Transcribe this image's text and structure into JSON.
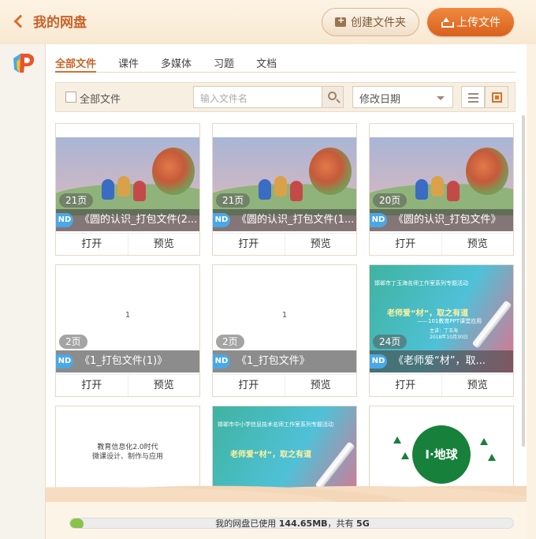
{
  "header": {
    "title": "我的网盘",
    "create_folder": "创建文件夹",
    "upload": "上传文件"
  },
  "tabs": [
    "全部文件",
    "课件",
    "多媒体",
    "习题",
    "文档"
  ],
  "active_tab": 0,
  "filter": {
    "select_all": "全部文件",
    "search_placeholder": "输入文件名",
    "sort": "修改日期"
  },
  "files": [
    {
      "badge": "ND",
      "pages": "21页",
      "name": "《圆的认识_打包文件(2...",
      "thumb": "cartoon"
    },
    {
      "badge": "ND",
      "pages": "21页",
      "name": "《圆的认识_打包文件(1...",
      "thumb": "cartoon"
    },
    {
      "badge": "ND",
      "pages": "20页",
      "name": "《圆的认识_打包文件》",
      "thumb": "cartoon"
    },
    {
      "badge": "ND",
      "pages": "2页",
      "name": "《1_打包文件(1)》",
      "thumb": "blank",
      "thumb_text": "1"
    },
    {
      "badge": "ND",
      "pages": "2页",
      "name": "《1_打包文件》",
      "thumb": "blank",
      "thumb_text": "1"
    },
    {
      "badge": "ND",
      "pages": "24页",
      "name": "《老师爱“材”，取...",
      "thumb": "ppt",
      "thumb_lines": [
        "邯郸市丁玉海名师工作室系列专题活动",
        "老师爱“材”，取之有道",
        "——101教育PPT课堂应用",
        "主讲：丁玉海",
        "2018年10月30日"
      ]
    },
    {
      "thumb": "doc",
      "thumb_lines": [
        "教育信息化2.0时代",
        "微课设计、制作与应用"
      ]
    },
    {
      "thumb": "ppt",
      "thumb_lines": [
        "邯郸市中小学信息技术名师工作室系列专题活动",
        "老师爱“材”，取之有道"
      ]
    },
    {
      "thumb": "globe",
      "thumb_lines": [
        "I·地球"
      ]
    }
  ],
  "card_actions": {
    "open": "打开",
    "preview": "预览"
  },
  "footer": {
    "quota_prefix": "我的网盘已使用 ",
    "used": "144.65MB",
    "quota_mid": "，共有 ",
    "total": "5G",
    "used_fraction": 0.03
  },
  "colors": {
    "accent": "#d9702a",
    "nd_badge": "#4aa8e8",
    "quota_fill": "#8ac24a"
  }
}
